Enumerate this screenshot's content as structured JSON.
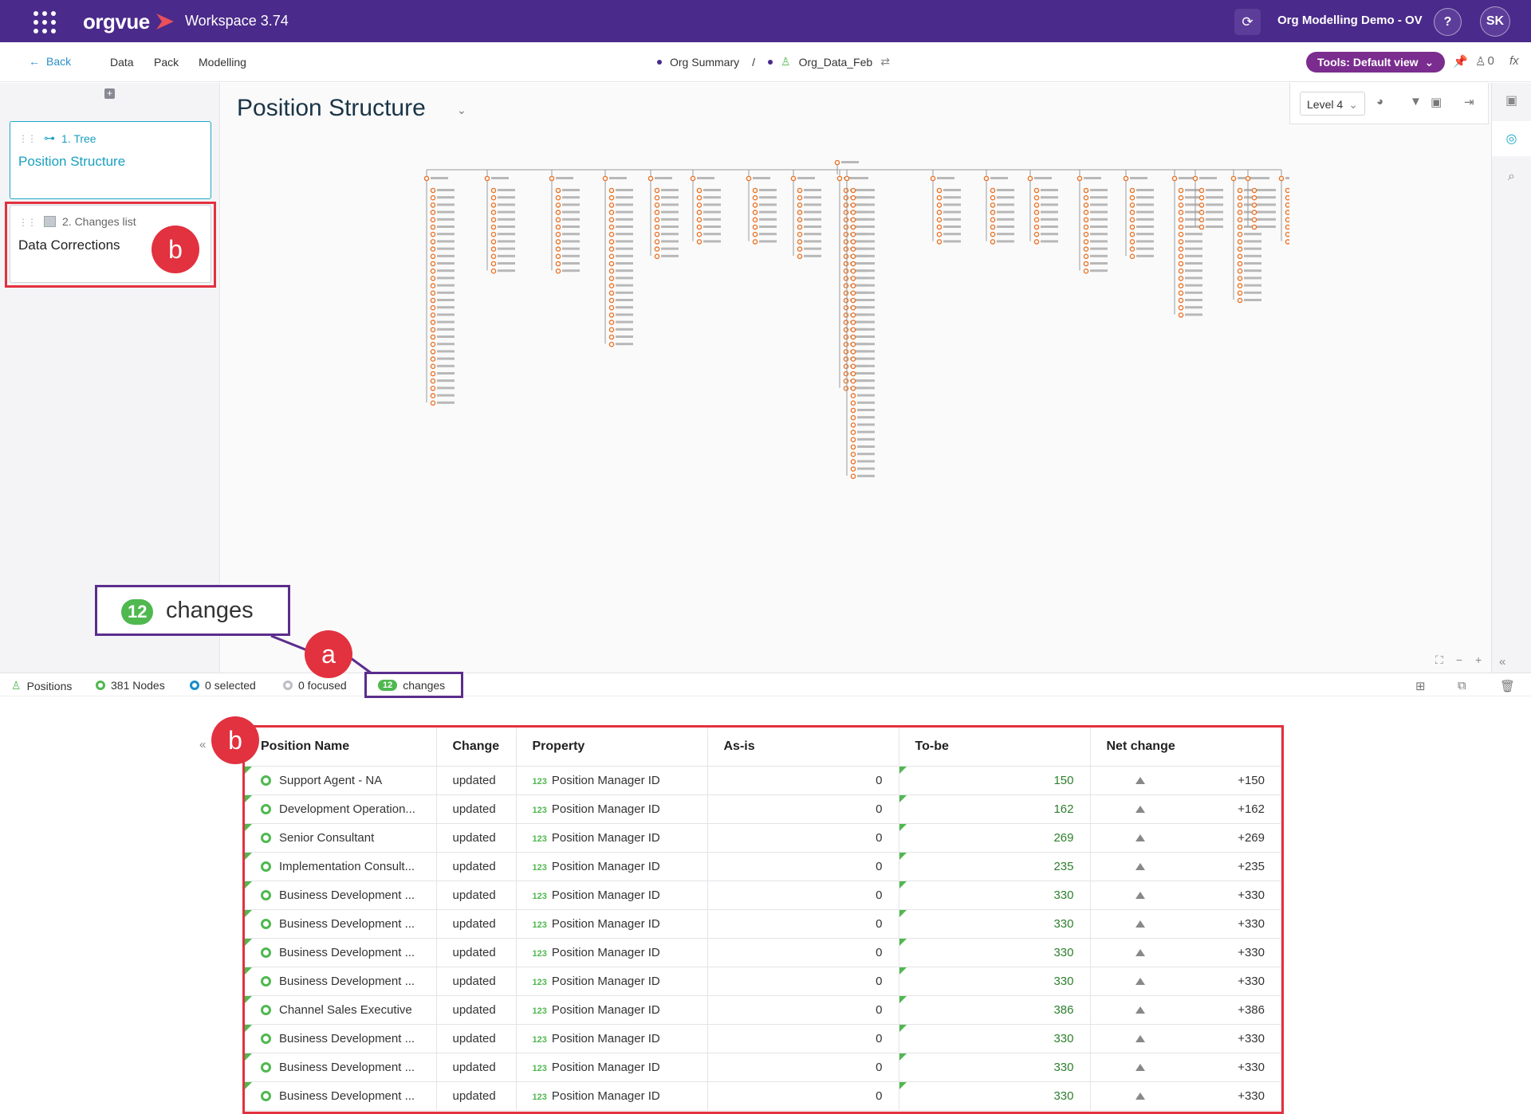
{
  "topbar": {
    "logo": "orgvue",
    "workspace": "Workspace 3.74",
    "project": "Org Modelling Demo - OV",
    "help": "?",
    "user_initials": "SK",
    "accent": "#4a2a8a"
  },
  "nav": {
    "back": "Back",
    "links": [
      "Data",
      "Pack",
      "Modelling"
    ],
    "breadcrumb_summary": "Org Summary",
    "breadcrumb_sep": "/",
    "breadcrumb_dataset": "Org_Data_Feb",
    "tools": "Tools: Default view",
    "alerts": "0",
    "fx": "fx"
  },
  "views": [
    {
      "kind": "1. Tree",
      "title": "Position Structure",
      "active": true
    },
    {
      "kind": "2. Changes list",
      "title": "Data Corrections",
      "active": false
    }
  ],
  "page": {
    "title": "Position Structure",
    "level": "Level 4"
  },
  "statusbar": {
    "positions": "Positions",
    "nodes": "381 Nodes",
    "selected": "0 selected",
    "focused": "0 focused",
    "changes_count": "12",
    "changes_label": "changes"
  },
  "callouts": {
    "a": "a",
    "b": "b",
    "big_count": "12",
    "big_label": "changes"
  },
  "table": {
    "headers": [
      "Position Name",
      "Change",
      "Property",
      "As-is",
      "To-be",
      "Net change"
    ],
    "rows": [
      {
        "name": "Support Agent - NA",
        "change": "updated",
        "property": "Position Manager ID",
        "asis": "0",
        "tobe": "150",
        "net": "+150"
      },
      {
        "name": "Development Operation...",
        "change": "updated",
        "property": "Position Manager ID",
        "asis": "0",
        "tobe": "162",
        "net": "+162"
      },
      {
        "name": "Senior Consultant",
        "change": "updated",
        "property": "Position Manager ID",
        "asis": "0",
        "tobe": "269",
        "net": "+269"
      },
      {
        "name": "Implementation Consult...",
        "change": "updated",
        "property": "Position Manager ID",
        "asis": "0",
        "tobe": "235",
        "net": "+235"
      },
      {
        "name": "Business Development ...",
        "change": "updated",
        "property": "Position Manager ID",
        "asis": "0",
        "tobe": "330",
        "net": "+330"
      },
      {
        "name": "Business Development ...",
        "change": "updated",
        "property": "Position Manager ID",
        "asis": "0",
        "tobe": "330",
        "net": "+330"
      },
      {
        "name": "Business Development ...",
        "change": "updated",
        "property": "Position Manager ID",
        "asis": "0",
        "tobe": "330",
        "net": "+330"
      },
      {
        "name": "Business Development ...",
        "change": "updated",
        "property": "Position Manager ID",
        "asis": "0",
        "tobe": "330",
        "net": "+330"
      },
      {
        "name": "Channel Sales Executive",
        "change": "updated",
        "property": "Position Manager ID",
        "asis": "0",
        "tobe": "386",
        "net": "+386"
      },
      {
        "name": "Business Development ...",
        "change": "updated",
        "property": "Position Manager ID",
        "asis": "0",
        "tobe": "330",
        "net": "+330"
      },
      {
        "name": "Business Development ...",
        "change": "updated",
        "property": "Position Manager ID",
        "asis": "0",
        "tobe": "330",
        "net": "+330"
      },
      {
        "name": "Business Development ...",
        "change": "updated",
        "property": "Position Manager ID",
        "asis": "0",
        "tobe": "330",
        "net": "+330"
      }
    ]
  },
  "colors": {
    "purple": "#4a2a8a",
    "green": "#4fb84f",
    "teal": "#1ba8c6",
    "red": "#e2313f",
    "orange": "#e8762b"
  }
}
